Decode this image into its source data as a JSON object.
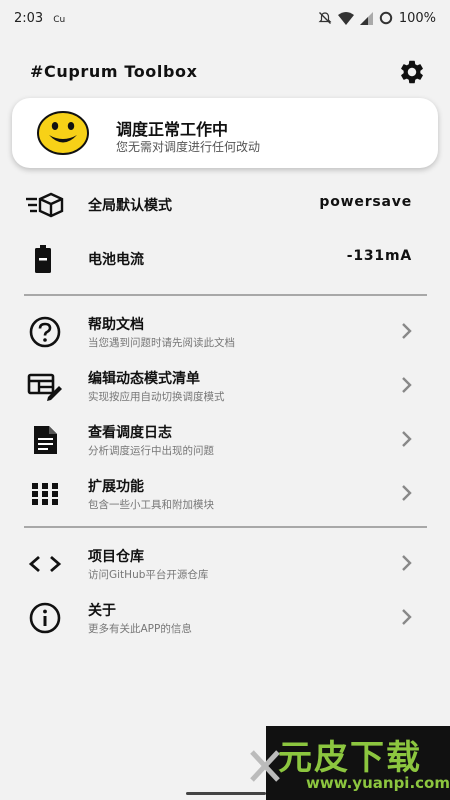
{
  "status": {
    "time": "2:03",
    "carrier_icon": "Cu",
    "battery": "100%"
  },
  "app": {
    "title": "#Cuprum Toolbox"
  },
  "scheduler_card": {
    "title": "调度正常工作中",
    "subtitle": "您无需对调度进行任何改动",
    "icon": "smiley-face-icon",
    "icon_color": "#f7d117"
  },
  "info_rows": [
    {
      "label": "全局默认模式",
      "value": "powersave",
      "icon": "mode-cube-icon"
    },
    {
      "label": "电池电流",
      "value": "-131mA",
      "icon": "battery-icon"
    }
  ],
  "menu_items": [
    {
      "label": "帮助文档",
      "sub": "当您遇到问题时请先阅读此文档",
      "icon": "help-circle-icon"
    },
    {
      "label": "编辑动态模式清单",
      "sub": "实现按应用自动切换调度模式",
      "icon": "edit-list-icon"
    },
    {
      "label": "查看调度日志",
      "sub": "分析调度运行中出现的问题",
      "icon": "log-document-icon"
    },
    {
      "label": "扩展功能",
      "sub": "包含一些小工具和附加模块",
      "icon": "apps-grid-icon"
    }
  ],
  "about_items": [
    {
      "label": "项目仓库",
      "sub": "访问GitHub平台开源仓库",
      "icon": "code-brackets-icon"
    },
    {
      "label": "关于",
      "sub": "更多有关此APP的信息",
      "icon": "info-circle-icon"
    }
  ],
  "watermark": {
    "main": "元皮下载",
    "url": "www.yuanpi.com"
  }
}
